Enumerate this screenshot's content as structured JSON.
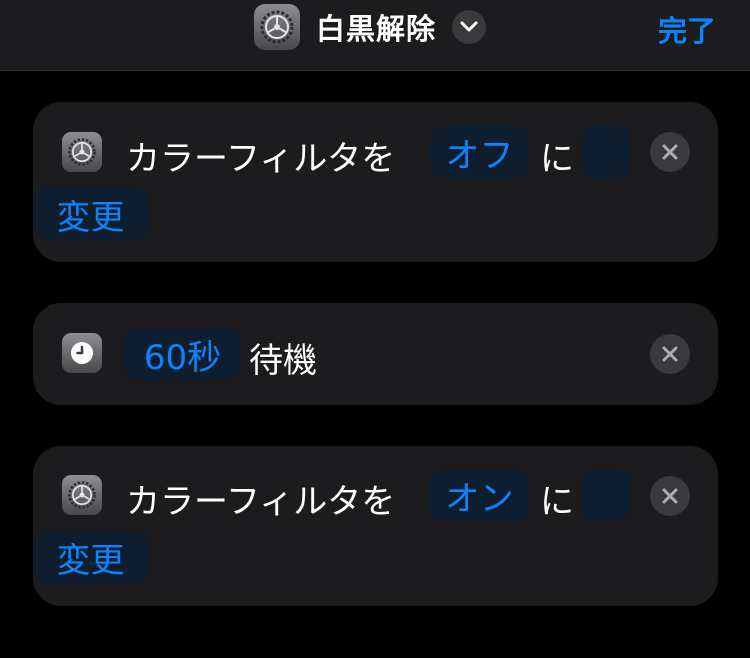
{
  "header": {
    "title": "白黒解除",
    "done_label": "完了"
  },
  "actions": [
    {
      "icon": "settings-icon",
      "text_prefix": "カラーフィルタを",
      "value": "オフ",
      "connector": "に",
      "verb": "変更"
    },
    {
      "icon": "clock-icon",
      "duration": "60秒",
      "verb": "待機"
    },
    {
      "icon": "settings-icon",
      "text_prefix": "カラーフィルタを",
      "value": "オン",
      "connector": "に",
      "verb": "変更"
    }
  ],
  "colors": {
    "accent": "#0a84ff",
    "card": "#1c1c1e",
    "background": "#000000"
  }
}
